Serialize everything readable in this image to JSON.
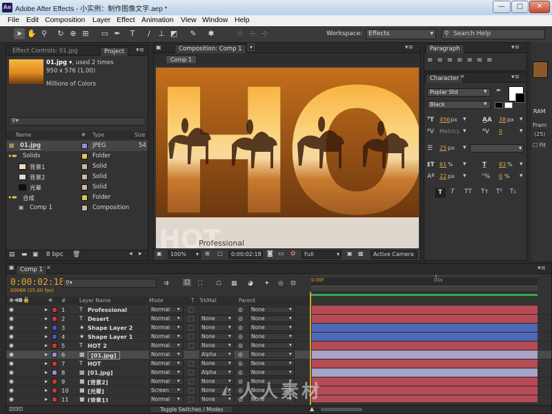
{
  "window": {
    "title": "Adobe After Effects - 小实例：制作图像文字.aep *",
    "app_icon": "Ae",
    "minimize": "—",
    "maximize": "□",
    "close": "✕"
  },
  "menu": [
    "File",
    "Edit",
    "Composition",
    "Layer",
    "Effect",
    "Animation",
    "View",
    "Window",
    "Help"
  ],
  "toolbar": {
    "workspace_label": "Workspace:",
    "workspace_value": "Effects",
    "search_placeholder": "Search Help"
  },
  "project": {
    "tab_effect_controls": "Effect Controls: 01.jpg",
    "tab_project": "Project",
    "item_name": "01.jpg ▾",
    "used": ", used 2 times",
    "dims": "950 x 576 (1.00)",
    "colors": "Millions of Colors",
    "columns": {
      "name": "Name",
      "type": "Type",
      "size": "Size"
    },
    "rows": [
      {
        "name": "01.jpg",
        "type": "JPEG",
        "size": "54",
        "label_color": "#8f8fd6",
        "indent": 0,
        "kind": "file"
      },
      {
        "name": "Solids",
        "type": "Folder",
        "size": "",
        "label_color": "#e3c34a",
        "indent": 0,
        "kind": "folder"
      },
      {
        "name": "背景1",
        "type": "Solid",
        "size": "",
        "label_color": "#c9b89a",
        "indent": 1,
        "kind": "solid",
        "swatch": "#f2d9c0"
      },
      {
        "name": "背景2",
        "type": "Solid",
        "size": "",
        "label_color": "#c9b89a",
        "indent": 1,
        "kind": "solid",
        "swatch": "#d8d8d8"
      },
      {
        "name": "光晕",
        "type": "Solid",
        "size": "",
        "label_color": "#c9b89a",
        "indent": 1,
        "kind": "solid",
        "swatch": "#111111"
      },
      {
        "name": "合成",
        "type": "Folder",
        "size": "",
        "label_color": "#e3c34a",
        "indent": 0,
        "kind": "folder"
      },
      {
        "name": "Comp 1",
        "type": "Composition",
        "size": "",
        "label_color": "#c9b89a",
        "indent": 1,
        "kind": "comp"
      }
    ],
    "bpc": "8 bpc"
  },
  "composition": {
    "tab": "Composition: Comp 1",
    "subtab": "Comp 1",
    "viewer_text": "HOT",
    "overlay_text": "Professional",
    "zoom": "100%",
    "timecode": "0:00:02:18",
    "resolution": "Full",
    "camera": "Active Camera"
  },
  "paragraph": {
    "tab": "Paragraph"
  },
  "character": {
    "tab": "Character",
    "font": "Poplar Std",
    "style": "Black",
    "font_size": "456",
    "font_size_unit": "px",
    "leading": "38",
    "leading_unit": "px",
    "kerning": "Metrics",
    "tracking": "0",
    "stroke_width": "25",
    "stroke_unit": "px",
    "vscale": "61",
    "hscale": "83",
    "pct": "%",
    "baseline": "22",
    "baseline_unit": "px",
    "tsume": "0",
    "formats": [
      "T",
      "T",
      "TT",
      "Tт",
      "T¹",
      "T₁"
    ]
  },
  "info": {
    "ram": "RAM",
    "fram": "Fram",
    "num": "(25)",
    "fit": "Fit"
  },
  "timeline": {
    "tab": "Comp 1",
    "time": "0:00:02:18",
    "frames": "00068 (25.00 fps)",
    "columns": {
      "num": "#",
      "layer": "Layer Name",
      "mode": "Mode",
      "t": "T",
      "trkmat": "TrkMat",
      "parent": "Parent"
    },
    "ruler": [
      "0:00f",
      "01s"
    ],
    "bottom_label": "Toggle Switches / Modes",
    "layers": [
      {
        "num": "1",
        "name": "Professional",
        "type": "text",
        "mode": "Normal",
        "trkmat": "",
        "parent": "None",
        "color": "#c43a3a",
        "bar": "#b54b54"
      },
      {
        "num": "2",
        "name": "Desert",
        "type": "text",
        "mode": "Normal",
        "trkmat": "None",
        "parent": "None",
        "color": "#c43a3a",
        "bar": "#b54b54"
      },
      {
        "num": "3",
        "name": "Shape Layer 2",
        "type": "shape",
        "mode": "Normal",
        "trkmat": "None",
        "parent": "None",
        "color": "#4059c4",
        "bar": "#4d69b8"
      },
      {
        "num": "4",
        "name": "Shape Layer 1",
        "type": "shape",
        "mode": "Normal",
        "trkmat": "None",
        "parent": "None",
        "color": "#4059c4",
        "bar": "#4d69b8"
      },
      {
        "num": "5",
        "name": "HOT 2",
        "type": "text",
        "mode": "Normal",
        "trkmat": "None",
        "parent": "None",
        "color": "#c43a3a",
        "bar": "#b54b54"
      },
      {
        "num": "6",
        "name": "[01.jpg]",
        "type": "image",
        "mode": "Normal",
        "trkmat": "Alpha",
        "parent": "None",
        "color": "#9a8fd6",
        "bar": "#a8a2c9"
      },
      {
        "num": "7",
        "name": "HOT",
        "type": "text",
        "mode": "Normal",
        "trkmat": "None",
        "parent": "None",
        "color": "#c43a3a",
        "bar": "#b54b54"
      },
      {
        "num": "8",
        "name": "[01.jpg]",
        "type": "image",
        "mode": "Normal",
        "trkmat": "Alpha",
        "parent": "None",
        "color": "#9a8fd6",
        "bar": "#a8a2c9"
      },
      {
        "num": "9",
        "name": "[背景2]",
        "type": "solid",
        "mode": "Normal",
        "trkmat": "None",
        "parent": "None",
        "color": "#c43a3a",
        "bar": "#b54b54"
      },
      {
        "num": "10",
        "name": "[光晕]",
        "type": "solid",
        "mode": "Screen",
        "trkmat": "None",
        "parent": "None",
        "color": "#c43a3a",
        "bar": "#b54b54"
      },
      {
        "num": "11",
        "name": "[背景1]",
        "type": "solid",
        "mode": "Normal",
        "trkmat": "None",
        "parent": "None",
        "color": "#c43a3a",
        "bar": "#b54b54"
      }
    ]
  },
  "watermark": "人人素材"
}
